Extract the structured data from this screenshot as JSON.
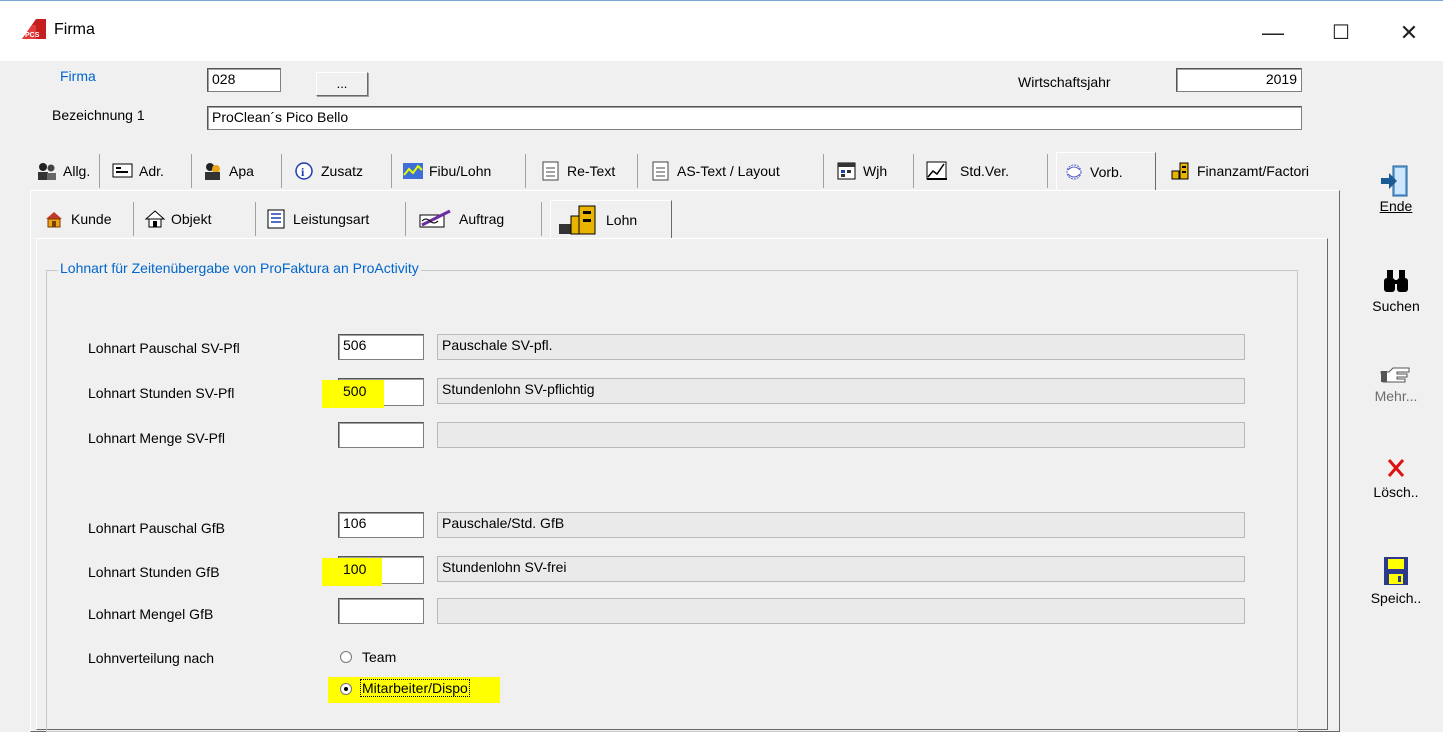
{
  "window": {
    "title": "Firma",
    "controls": {
      "minimize": "—",
      "maximize": "☐",
      "close": "✕"
    }
  },
  "header": {
    "firma_label": "Firma",
    "firma_value": "028",
    "browse_label": "...",
    "wirtschaftsjahr_label": "Wirtschaftsjahr",
    "wirtschaftsjahr_value": "2019",
    "bezeichnung_label": "Bezeichnung 1",
    "bezeichnung_value": "ProClean´s Pico Bello"
  },
  "main_tabs": [
    {
      "label": "Allg."
    },
    {
      "label": "Adr."
    },
    {
      "label": "Apa"
    },
    {
      "label": "Zusatz"
    },
    {
      "label": "Fibu/Lohn"
    },
    {
      "label": "Re-Text"
    },
    {
      "label": "AS-Text / Layout"
    },
    {
      "label": "Wjh"
    },
    {
      "label": "Std.Ver."
    },
    {
      "label": "Vorb."
    },
    {
      "label": "Finanzamt/Factori"
    }
  ],
  "sub_tabs": [
    {
      "label": "Kunde"
    },
    {
      "label": "Objekt"
    },
    {
      "label": "Leistungsart"
    },
    {
      "label": "Auftrag"
    },
    {
      "label": "Lohn"
    }
  ],
  "group": {
    "title": "Lohnart für Zeitenübergabe von ProFaktura an ProActivity",
    "rows": [
      {
        "label": "Lohnart Pauschal SV-Pfl",
        "code": "506",
        "desc": "Pauschale SV-pfl."
      },
      {
        "label": "Lohnart Stunden SV-Pfl",
        "code": "500",
        "desc": "Stundenlohn SV-pflichtig"
      },
      {
        "label": "Lohnart Menge SV-Pfl",
        "code": "",
        "desc": ""
      },
      {
        "label": "Lohnart Pauschal GfB",
        "code": "106",
        "desc": "Pauschale/Std. GfB"
      },
      {
        "label": "Lohnart Stunden GfB",
        "code": "100",
        "desc": "Stundenlohn SV-frei"
      },
      {
        "label": "Lohnart Mengel GfB",
        "code": "",
        "desc": ""
      }
    ],
    "verteilung_label": "Lohnverteilung nach",
    "radio_options": [
      {
        "label": "Team",
        "selected": false
      },
      {
        "label": "Mitarbeiter/Dispo",
        "selected": true
      }
    ]
  },
  "sidebar": {
    "ende": "Ende",
    "suchen": "Suchen",
    "mehr": "Mehr...",
    "loesch": "Lösch..",
    "speich": "Speich.."
  },
  "colors": {
    "link_blue": "#0066cc",
    "highlight": "#ffff00"
  }
}
